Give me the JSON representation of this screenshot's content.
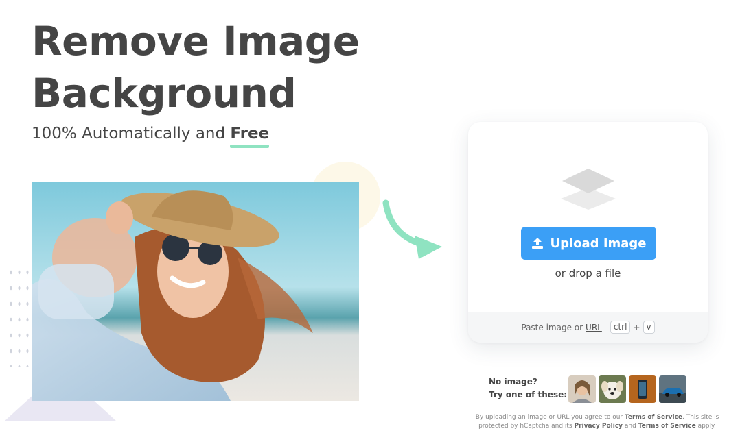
{
  "hero": {
    "title": "Remove Image Background",
    "subtitle_prefix": "100% Automatically and ",
    "subtitle_emphasis": "Free"
  },
  "upload": {
    "button_label": "Upload Image",
    "drop_text": "or drop a file",
    "paste_prefix": "Paste image or ",
    "paste_link": "URL",
    "key_ctrl": "ctrl",
    "key_plus": "+",
    "key_v": "v"
  },
  "samples": {
    "label_line1": "No image?",
    "label_line2": "Try one of these:",
    "items": [
      "woman-portrait",
      "dog",
      "phone",
      "car"
    ]
  },
  "legal": {
    "p1": "By uploading an image or URL you agree to our ",
    "tos1": "Terms of Service",
    "p2": ". This site is protected by hCaptcha and its ",
    "privacy": "Privacy Policy",
    "p3": " and ",
    "tos2": "Terms of Service",
    "p4": " apply."
  },
  "colors": {
    "accent_blue": "#3b9ff6",
    "accent_green": "#8fe3c1",
    "text_dark": "#454545"
  },
  "icons": [
    "upload-icon",
    "layers-icon",
    "curved-arrow-icon"
  ]
}
